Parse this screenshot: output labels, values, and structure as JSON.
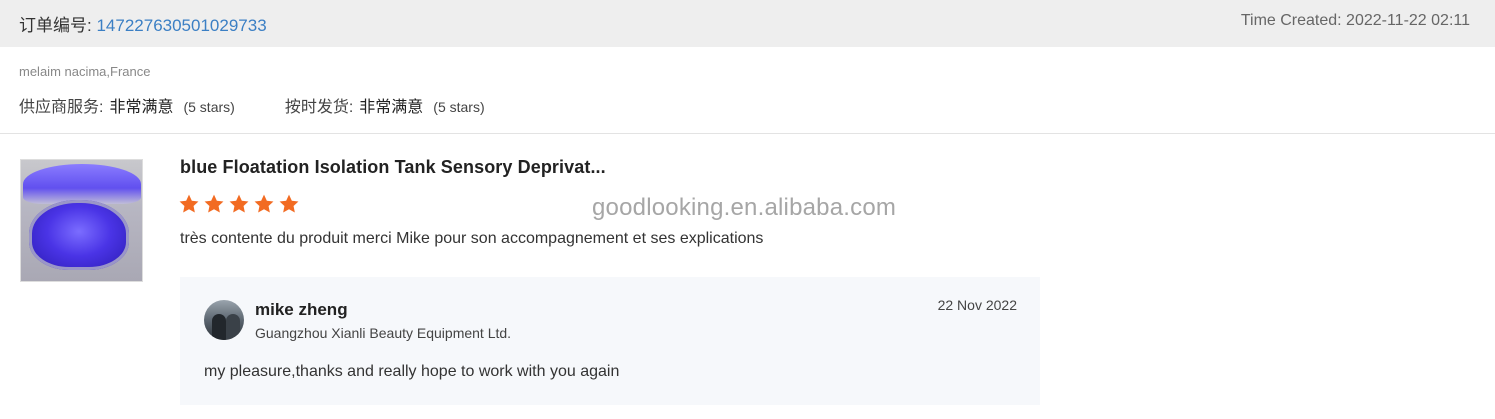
{
  "order": {
    "number_label": "订单编号:",
    "number_value": "147227630501029733",
    "time_created": "Time Created: 2022-11-22 02:11"
  },
  "buyer": {
    "name_location": "melaim nacima,France"
  },
  "ratings": [
    {
      "label": "供应商服务:",
      "value": "非常满意",
      "stars": "(5 stars)",
      "level": 5
    },
    {
      "label": "按时发货:",
      "value": "非常满意",
      "stars": "(5 stars)",
      "level": 5
    }
  ],
  "product": {
    "title": "blue Floatation Isolation Tank Sensory Deprivat...",
    "rating": 5,
    "review": "très contente du produit merci Mike pour son accompagnement et ses explications"
  },
  "watermark": "goodlooking.en.alibaba.com",
  "reply": {
    "name": "mike zheng",
    "company": "Guangzhou Xianli Beauty Equipment Ltd.",
    "date": "22 Nov 2022",
    "text": "my pleasure,thanks and really hope to work with you again"
  },
  "colors": {
    "header_bg": "#eeeeee",
    "order_number": "#3b7fc4",
    "star": "#f26b22",
    "reply_bg": "#f6f8fb"
  },
  "icons": {
    "star": "star-icon",
    "avatar": "avatar-image",
    "product": "product-thumbnail"
  }
}
